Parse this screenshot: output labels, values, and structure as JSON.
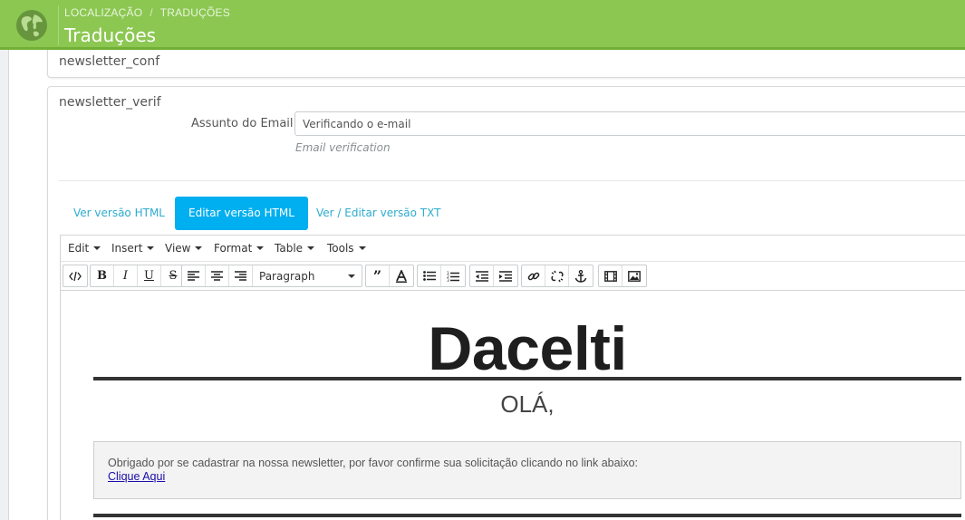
{
  "header": {
    "breadcrumb": [
      "LOCALIZAÇÃO",
      "TRADUÇÕES"
    ],
    "title": "Traduções",
    "icon": "globe-icon",
    "accent": "#8bc751"
  },
  "panels": {
    "first_title": "newsletter_conf",
    "second_title": "newsletter_verif"
  },
  "subject": {
    "label": "Assunto do Email",
    "value": "Verificando o e-mail",
    "help": "Email verification"
  },
  "tabs": [
    {
      "label": "Ver versão HTML",
      "active": false
    },
    {
      "label": "Editar versão HTML",
      "active": true
    },
    {
      "label": "Ver / Editar versão TXT",
      "active": false
    }
  ],
  "editor": {
    "menus": [
      "Edit",
      "Insert",
      "View",
      "Format",
      "Table",
      "Tools"
    ],
    "format_select": "Paragraph",
    "toolbar_icons": [
      "code-icon",
      "bold-icon",
      "italic-icon",
      "underline-icon",
      "strikethrough-icon",
      "align-left-icon",
      "align-center-icon",
      "align-right-icon",
      "blockquote-icon",
      "text-color-icon",
      "bullet-list-icon",
      "numbered-list-icon",
      "outdent-icon",
      "indent-icon",
      "link-icon",
      "unlink-icon",
      "anchor-icon",
      "media-icon",
      "image-icon"
    ]
  },
  "email": {
    "brand": "Dacelti",
    "greeting": "OLÁ,",
    "message": "Obrigado por se cadastrar na nossa newsletter, por favor confirme sua solicitação clicando no link abaixo:",
    "link": "Clique Aqui"
  }
}
